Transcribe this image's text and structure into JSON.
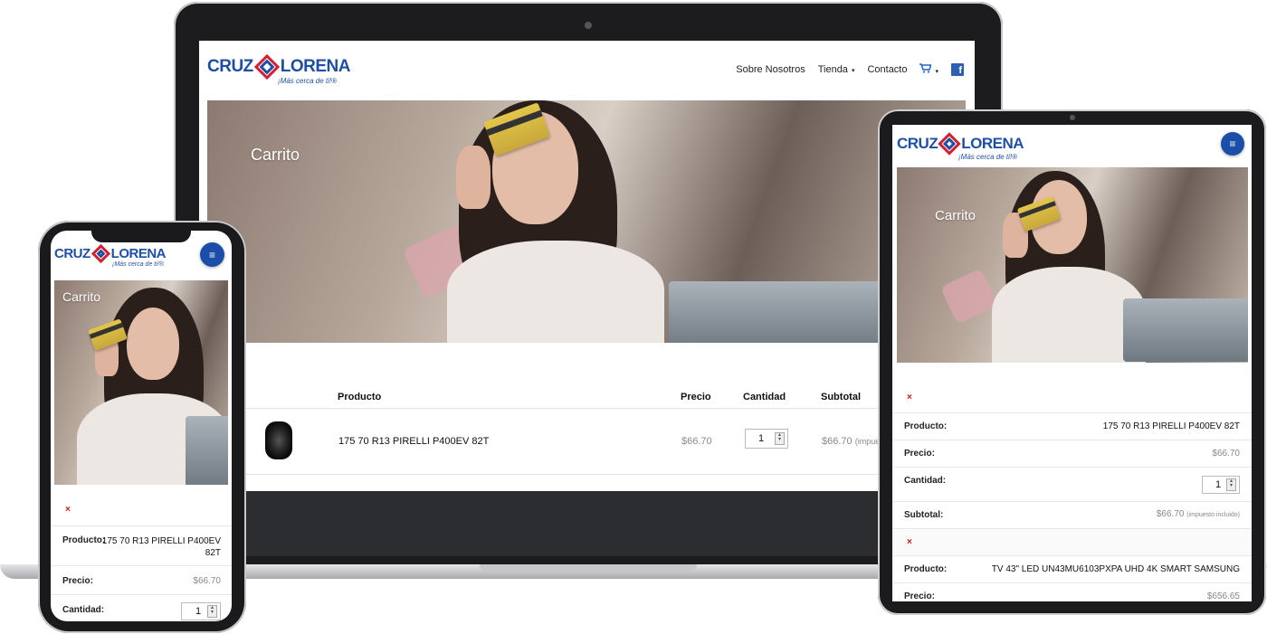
{
  "brand": {
    "name_left": "CRUZ",
    "name_right": "LORENA",
    "tagline": "¡Más cerca de ti!®"
  },
  "nav": {
    "items": [
      "Sobre Nosotros",
      "Tienda",
      "Contacto"
    ],
    "cart_icon": "cart-icon",
    "facebook_icon": "facebook-icon",
    "facebook_glyph": "f",
    "caret": "▾",
    "menu_icon": "menu-icon",
    "menu_glyph": "≡"
  },
  "hero": {
    "title": "Carrito"
  },
  "table": {
    "headers": {
      "product": "Producto",
      "price": "Precio",
      "quantity": "Cantidad",
      "subtotal": "Subtotal"
    },
    "rows": [
      {
        "product": "175 70 R13 PIRELLI P400EV 82T",
        "price": "$66.70",
        "quantity": "1",
        "subtotal": "$66.70",
        "subtotal_note": "(impue"
      }
    ]
  },
  "mobile_cart": {
    "remove_glyph": "×",
    "labels": {
      "product": "Producto:",
      "price": "Precio:",
      "quantity": "Cantidad:",
      "subtotal": "Subtotal:"
    },
    "tax_note": "(impuesto incluido)",
    "items": [
      {
        "product": "175 70 R13 PIRELLI P400EV 82T",
        "product_line1": "175 70 R13 PIRELLI P400EV",
        "product_line2": "82T",
        "price": "$66.70",
        "quantity": "1",
        "subtotal": "$66.70"
      },
      {
        "product": "TV 43\" LED UN43MU6103PXPA UHD 4K SMART SAMSUNG",
        "price": "$656.65"
      }
    ]
  },
  "colors": {
    "brand_blue": "#1f4fa5",
    "brand_red": "#d32030",
    "remove_red": "#d0121b",
    "footer": "#2c2d31"
  }
}
